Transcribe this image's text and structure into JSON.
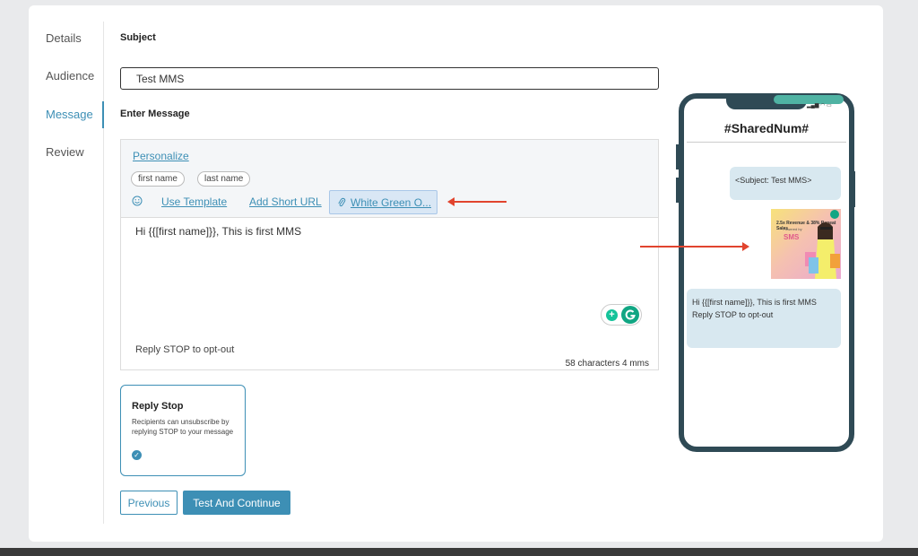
{
  "nav": {
    "items": [
      "Details",
      "Audience",
      "Message",
      "Review"
    ],
    "active_index": 2
  },
  "subject": {
    "label": "Subject",
    "value": "Test MMS"
  },
  "message": {
    "label": "Enter Message",
    "personalize": "Personalize",
    "chips": [
      "first name",
      "last name"
    ],
    "toolbar": {
      "emoji_icon": "smiley-icon",
      "use_template": "Use Template",
      "add_short_url": "Add Short URL",
      "attachment": "White Green O..."
    },
    "body": "Hi {{[first name]}}, This is first MMS",
    "opt_out": "Reply STOP to opt-out",
    "counter": "58 characters 4 mms"
  },
  "reply_stop": {
    "title": "Reply Stop",
    "description": "Recipients can unsubscribe by replying STOP to your message",
    "checked": true
  },
  "buttons": {
    "previous": "Previous",
    "next": "Test And Continue"
  },
  "preview": {
    "title": "#SharedNum#",
    "subject_bubble": "<Subject: Test MMS>",
    "image_text": [
      "2.5x Revenue & 38% Repeat Sales",
      "~ Powered by",
      "SMS"
    ],
    "message_lines": [
      "Hi {{[first name]}}, This is first MMS",
      "Reply STOP to opt-out"
    ]
  },
  "colors": {
    "accent": "#3d8fb5",
    "arrow": "#e1442e",
    "phone_frame": "#2f4a55",
    "bubble": "#d8e8f0"
  }
}
